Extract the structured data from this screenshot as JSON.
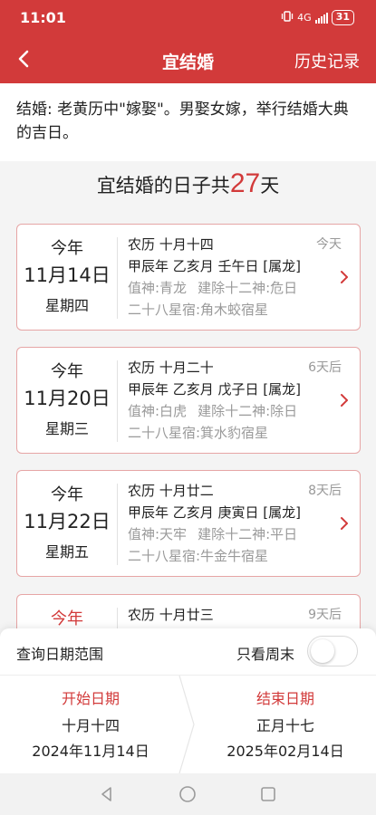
{
  "status": {
    "time": "11:01",
    "signal": "4G",
    "battery": "31"
  },
  "appbar": {
    "title": "宜结婚",
    "history": "历史记录"
  },
  "description": "结婚: 老黄历中\"嫁娶\"。男娶女嫁，举行结婚大典的吉日。",
  "headline": {
    "prefix": "宜结婚的日子共",
    "count": "27",
    "suffix": "天"
  },
  "days": [
    {
      "year": "今年",
      "date": "11月14日",
      "weekday": "星期四",
      "lunar": "农历 十月十四",
      "relative": "今天",
      "ganzhi": "甲辰年 乙亥月 壬午日 [属龙]",
      "zhishen": "值神:青龙",
      "jianchu": "建除十二神:危日",
      "xiu": "二十八星宿:角木蛟宿星"
    },
    {
      "year": "今年",
      "date": "11月20日",
      "weekday": "星期三",
      "lunar": "农历 十月二十",
      "relative": "6天后",
      "ganzhi": "甲辰年 乙亥月 戊子日 [属龙]",
      "zhishen": "值神:白虎",
      "jianchu": "建除十二神:除日",
      "xiu": "二十八星宿:箕水豹宿星"
    },
    {
      "year": "今年",
      "date": "11月22日",
      "weekday": "星期五",
      "lunar": "农历 十月廿二",
      "relative": "8天后",
      "ganzhi": "甲辰年 乙亥月 庚寅日 [属龙]",
      "zhishen": "值神:天牢",
      "jianchu": "建除十二神:平日",
      "xiu": "二十八星宿:牛金牛宿星"
    },
    {
      "year": "今年",
      "lunar": "农历 十月廿三",
      "relative": "9天后"
    }
  ],
  "panel": {
    "range_label": "查询日期范围",
    "weekend_label": "只看周末",
    "weekend_only": false,
    "start": {
      "label": "开始日期",
      "lunar": "十月十四",
      "solar": "2024年11月14日"
    },
    "end": {
      "label": "结束日期",
      "lunar": "正月十七",
      "solar": "2025年02月14日"
    }
  },
  "colors": {
    "accent": "#d23a3a"
  },
  "icons": [
    "back-arrow-icon",
    "chevron-right-icon",
    "nav-back-icon",
    "nav-home-icon",
    "nav-recents-icon"
  ]
}
